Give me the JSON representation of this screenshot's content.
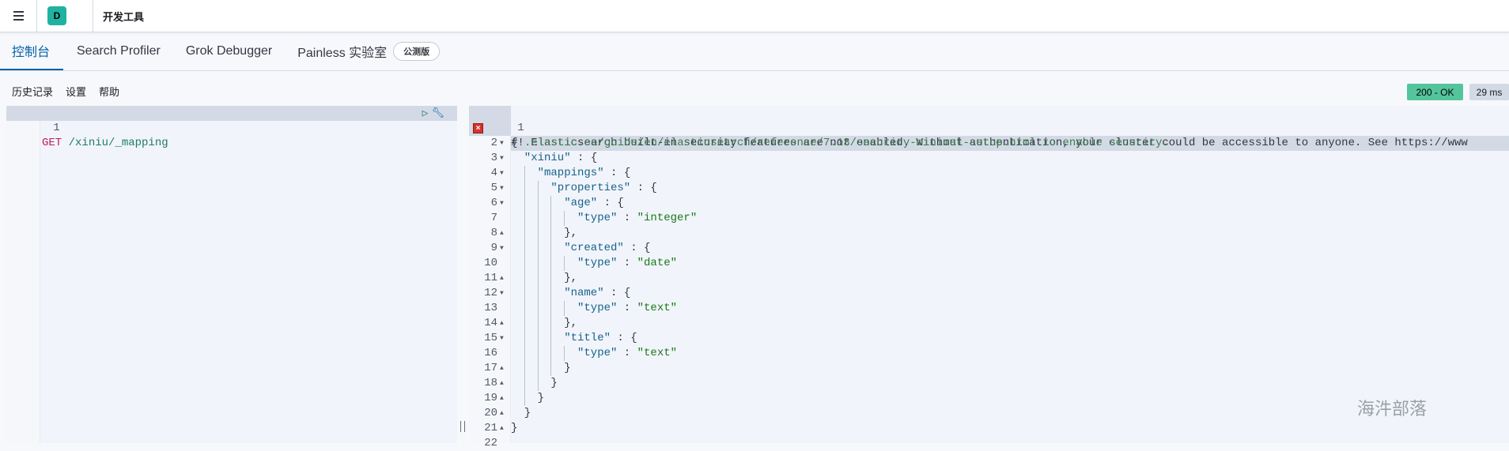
{
  "header": {
    "space_initial": "D",
    "breadcrumb": "开发工具"
  },
  "tabs": [
    {
      "label": "控制台",
      "active": true
    },
    {
      "label": "Search Profiler"
    },
    {
      "label": "Grok Debugger"
    },
    {
      "label": "Painless 实验室",
      "badge": "公测版"
    }
  ],
  "toolbar": {
    "history": "历史记录",
    "settings": "设置",
    "help": "帮助"
  },
  "status": {
    "code": "200 - OK",
    "time": "29 ms",
    "ok_color": "#54c49c"
  },
  "request": {
    "line_number": "1",
    "method": "GET",
    "path": " /xiniu/_mapping",
    "run_icon": "play-icon",
    "menu_icon": "wrench-icon"
  },
  "response": {
    "warning_line1": "#! Elasticsearch built-in security features are not enabled. Without authentication, your cluster could be accessible to anyone. See https://www",
    "warning_line2": ".elastic.co/guide/en/elasticsearch/reference/7.13/security-minimal-setup.html to enable security.",
    "lines": [
      {
        "n": "2",
        "indent": 0,
        "fold": "down",
        "punct": "{"
      },
      {
        "n": "3",
        "indent": 1,
        "fold": "down",
        "key": "\"xiniu\"",
        "punct": " : {"
      },
      {
        "n": "4",
        "indent": 2,
        "fold": "down",
        "key": "\"mappings\"",
        "punct": " : {"
      },
      {
        "n": "5",
        "indent": 3,
        "fold": "down",
        "key": "\"properties\"",
        "punct": " : {"
      },
      {
        "n": "6",
        "indent": 4,
        "fold": "down",
        "key": "\"age\"",
        "punct": " : {"
      },
      {
        "n": "7",
        "indent": 5,
        "key": "\"type\"",
        "punct": " : ",
        "value": "\"integer\""
      },
      {
        "n": "8",
        "indent": 4,
        "fold": "up",
        "punct": "},"
      },
      {
        "n": "9",
        "indent": 4,
        "fold": "down",
        "key": "\"created\"",
        "punct": " : {"
      },
      {
        "n": "10",
        "indent": 5,
        "key": "\"type\"",
        "punct": " : ",
        "value": "\"date\""
      },
      {
        "n": "11",
        "indent": 4,
        "fold": "up",
        "punct": "},"
      },
      {
        "n": "12",
        "indent": 4,
        "fold": "down",
        "key": "\"name\"",
        "punct": " : {"
      },
      {
        "n": "13",
        "indent": 5,
        "key": "\"type\"",
        "punct": " : ",
        "value": "\"text\""
      },
      {
        "n": "14",
        "indent": 4,
        "fold": "up",
        "punct": "},"
      },
      {
        "n": "15",
        "indent": 4,
        "fold": "down",
        "key": "\"title\"",
        "punct": " : {"
      },
      {
        "n": "16",
        "indent": 5,
        "key": "\"type\"",
        "punct": " : ",
        "value": "\"text\""
      },
      {
        "n": "17",
        "indent": 4,
        "fold": "up",
        "punct": "}"
      },
      {
        "n": "18",
        "indent": 3,
        "fold": "up",
        "punct": "}"
      },
      {
        "n": "19",
        "indent": 2,
        "fold": "up",
        "punct": "}"
      },
      {
        "n": "20",
        "indent": 1,
        "fold": "up",
        "punct": "}"
      },
      {
        "n": "21",
        "indent": 0,
        "fold": "up",
        "punct": "}"
      },
      {
        "n": "22",
        "indent": 0,
        "punct": ""
      }
    ]
  },
  "watermark": "海汼部落"
}
